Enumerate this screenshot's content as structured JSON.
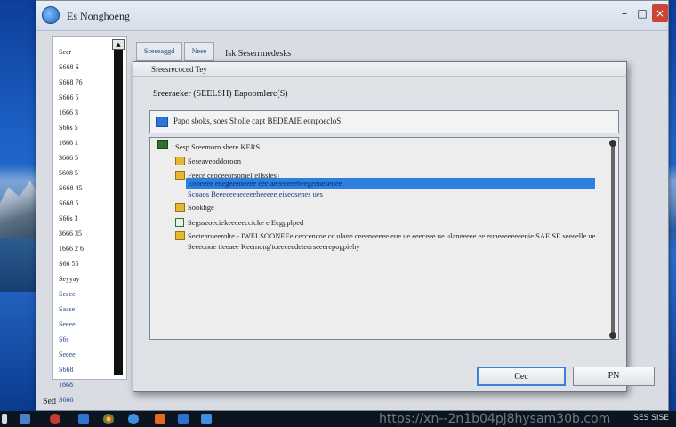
{
  "window": {
    "title": "Es Nonghoeng",
    "caption_min": "–",
    "caption_max": "□",
    "caption_close": "×"
  },
  "nav": {
    "items": [
      "Seer",
      "S668 S",
      "S668 76",
      "S666 5",
      "1666 3",
      "S66s 5",
      "1666 1",
      "3666 5",
      "5608 5",
      "S668 45",
      "S668 5",
      "S66s 3",
      "3666 35",
      "1666 2 6",
      "S66 55",
      "Seyyay",
      "Seeee",
      "Saase",
      "Seeee",
      "S6s",
      "Seeee",
      "S668",
      "1668",
      "S666"
    ],
    "blue_from_index": 16
  },
  "breadcrumb": {
    "tab1": "Sceeeaggd",
    "tab2": "Neee",
    "path": "Isk Seserrmedesks"
  },
  "dialog": {
    "title": "Sreesrecoced Tey",
    "subtitle": "Sreeraeker (SEELSH) Eapoomlerc(S)",
    "option_label": "Papo sboks, soes Sholle capt BEDEAIE eonpoecloS",
    "ok_label": "Cec",
    "cancel_label": "PN"
  },
  "tree": {
    "root": "Sesp Sreemorn shere KERS",
    "rows": [
      "Seseaveoddoroon",
      "Feece ceoceeorsomel(ellssles)",
      "Eooeeee eeegeeeneeee eee aeeeeeeebeegeenesenee",
      "Scoaos Beeeeeeaeceeeheeeeeieiseosenes ues",
      "Sookhge",
      "Segsseoeciekeeceeccicke e Ecgpplped",
      "Secteproeerolte - IWELSOONEEe ceccencoe ce ulane ceeeneeeee eue ue eeeceee ue ulaneeeee ee euneeeeeeeenie SAE SE seeeelle ue",
      "Seeecnoe tleeaee Keemong'toeeceedeteerseeerepogpiehy"
    ]
  },
  "status": {
    "text": "Sed"
  },
  "taskbar": {
    "watermark": "https://xn--2n1b04pj8hysam30b.com",
    "clock": "SES SISE"
  }
}
